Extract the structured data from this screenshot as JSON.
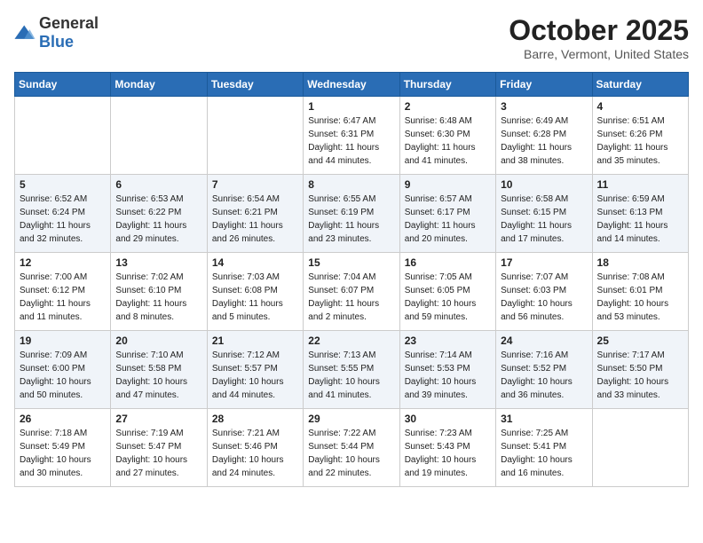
{
  "header": {
    "logo_general": "General",
    "logo_blue": "Blue",
    "month_title": "October 2025",
    "location": "Barre, Vermont, United States"
  },
  "weekdays": [
    "Sunday",
    "Monday",
    "Tuesday",
    "Wednesday",
    "Thursday",
    "Friday",
    "Saturday"
  ],
  "weeks": [
    [
      {
        "day": "",
        "sunrise": "",
        "sunset": "",
        "daylight": ""
      },
      {
        "day": "",
        "sunrise": "",
        "sunset": "",
        "daylight": ""
      },
      {
        "day": "",
        "sunrise": "",
        "sunset": "",
        "daylight": ""
      },
      {
        "day": "1",
        "sunrise": "6:47 AM",
        "sunset": "6:31 PM",
        "daylight": "11 hours and 44 minutes."
      },
      {
        "day": "2",
        "sunrise": "6:48 AM",
        "sunset": "6:30 PM",
        "daylight": "11 hours and 41 minutes."
      },
      {
        "day": "3",
        "sunrise": "6:49 AM",
        "sunset": "6:28 PM",
        "daylight": "11 hours and 38 minutes."
      },
      {
        "day": "4",
        "sunrise": "6:51 AM",
        "sunset": "6:26 PM",
        "daylight": "11 hours and 35 minutes."
      }
    ],
    [
      {
        "day": "5",
        "sunrise": "6:52 AM",
        "sunset": "6:24 PM",
        "daylight": "11 hours and 32 minutes."
      },
      {
        "day": "6",
        "sunrise": "6:53 AM",
        "sunset": "6:22 PM",
        "daylight": "11 hours and 29 minutes."
      },
      {
        "day": "7",
        "sunrise": "6:54 AM",
        "sunset": "6:21 PM",
        "daylight": "11 hours and 26 minutes."
      },
      {
        "day": "8",
        "sunrise": "6:55 AM",
        "sunset": "6:19 PM",
        "daylight": "11 hours and 23 minutes."
      },
      {
        "day": "9",
        "sunrise": "6:57 AM",
        "sunset": "6:17 PM",
        "daylight": "11 hours and 20 minutes."
      },
      {
        "day": "10",
        "sunrise": "6:58 AM",
        "sunset": "6:15 PM",
        "daylight": "11 hours and 17 minutes."
      },
      {
        "day": "11",
        "sunrise": "6:59 AM",
        "sunset": "6:13 PM",
        "daylight": "11 hours and 14 minutes."
      }
    ],
    [
      {
        "day": "12",
        "sunrise": "7:00 AM",
        "sunset": "6:12 PM",
        "daylight": "11 hours and 11 minutes."
      },
      {
        "day": "13",
        "sunrise": "7:02 AM",
        "sunset": "6:10 PM",
        "daylight": "11 hours and 8 minutes."
      },
      {
        "day": "14",
        "sunrise": "7:03 AM",
        "sunset": "6:08 PM",
        "daylight": "11 hours and 5 minutes."
      },
      {
        "day": "15",
        "sunrise": "7:04 AM",
        "sunset": "6:07 PM",
        "daylight": "11 hours and 2 minutes."
      },
      {
        "day": "16",
        "sunrise": "7:05 AM",
        "sunset": "6:05 PM",
        "daylight": "10 hours and 59 minutes."
      },
      {
        "day": "17",
        "sunrise": "7:07 AM",
        "sunset": "6:03 PM",
        "daylight": "10 hours and 56 minutes."
      },
      {
        "day": "18",
        "sunrise": "7:08 AM",
        "sunset": "6:01 PM",
        "daylight": "10 hours and 53 minutes."
      }
    ],
    [
      {
        "day": "19",
        "sunrise": "7:09 AM",
        "sunset": "6:00 PM",
        "daylight": "10 hours and 50 minutes."
      },
      {
        "day": "20",
        "sunrise": "7:10 AM",
        "sunset": "5:58 PM",
        "daylight": "10 hours and 47 minutes."
      },
      {
        "day": "21",
        "sunrise": "7:12 AM",
        "sunset": "5:57 PM",
        "daylight": "10 hours and 44 minutes."
      },
      {
        "day": "22",
        "sunrise": "7:13 AM",
        "sunset": "5:55 PM",
        "daylight": "10 hours and 41 minutes."
      },
      {
        "day": "23",
        "sunrise": "7:14 AM",
        "sunset": "5:53 PM",
        "daylight": "10 hours and 39 minutes."
      },
      {
        "day": "24",
        "sunrise": "7:16 AM",
        "sunset": "5:52 PM",
        "daylight": "10 hours and 36 minutes."
      },
      {
        "day": "25",
        "sunrise": "7:17 AM",
        "sunset": "5:50 PM",
        "daylight": "10 hours and 33 minutes."
      }
    ],
    [
      {
        "day": "26",
        "sunrise": "7:18 AM",
        "sunset": "5:49 PM",
        "daylight": "10 hours and 30 minutes."
      },
      {
        "day": "27",
        "sunrise": "7:19 AM",
        "sunset": "5:47 PM",
        "daylight": "10 hours and 27 minutes."
      },
      {
        "day": "28",
        "sunrise": "7:21 AM",
        "sunset": "5:46 PM",
        "daylight": "10 hours and 24 minutes."
      },
      {
        "day": "29",
        "sunrise": "7:22 AM",
        "sunset": "5:44 PM",
        "daylight": "10 hours and 22 minutes."
      },
      {
        "day": "30",
        "sunrise": "7:23 AM",
        "sunset": "5:43 PM",
        "daylight": "10 hours and 19 minutes."
      },
      {
        "day": "31",
        "sunrise": "7:25 AM",
        "sunset": "5:41 PM",
        "daylight": "10 hours and 16 minutes."
      },
      {
        "day": "",
        "sunrise": "",
        "sunset": "",
        "daylight": ""
      }
    ]
  ],
  "labels": {
    "sunrise_prefix": "Sunrise: ",
    "sunset_prefix": "Sunset: ",
    "daylight_label": "Daylight: "
  }
}
